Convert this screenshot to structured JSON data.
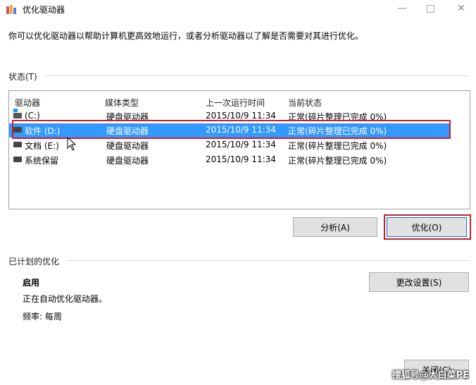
{
  "window": {
    "title": "优化驱动器"
  },
  "description": "你可以优化驱动器以帮助计算机更高效地运行，或者分析驱动器以了解是否需要对其进行优化。",
  "status_section": {
    "label": "状态(T)"
  },
  "list": {
    "columns": [
      "驱动器",
      "媒体类型",
      "上一次运行时间",
      "当前状态"
    ],
    "rows": [
      {
        "drive": "(C:)",
        "media": "硬盘驱动器",
        "last_run": "2015/10/9 11:34",
        "status": "正常(碎片整理已完成 0%)",
        "icon": "system-drive-icon"
      },
      {
        "drive": "软件 (D:)",
        "media": "硬盘驱动器",
        "last_run": "2015/10/9 11:34",
        "status": "正常(碎片整理已完成 0%)",
        "icon": "drive-icon",
        "selected": true
      },
      {
        "drive": "文档 (E:)",
        "media": "硬盘驱动器",
        "last_run": "2015/10/9 11:34",
        "status": "正常(碎片整理已完成 0%)",
        "icon": "drive-icon"
      },
      {
        "drive": "系统保留",
        "media": "硬盘驱动器",
        "last_run": "2015/10/9 11:34",
        "status": "正常(碎片整理已完成 0%)",
        "icon": "drive-icon"
      }
    ]
  },
  "buttons": {
    "analyze": "分析(A)",
    "optimize": "优化(O)",
    "change_settings": "更改设置(S)",
    "close": "关闭(C)"
  },
  "scheduled": {
    "label": "已计划的优化",
    "state": "启用",
    "detail": "正在自动优化驱动器。",
    "frequency": "频率: 每周"
  },
  "watermark": "搜狐号@大白菜PE",
  "colors": {
    "selection": "#3399ff",
    "highlight_border": "#c8202a"
  }
}
